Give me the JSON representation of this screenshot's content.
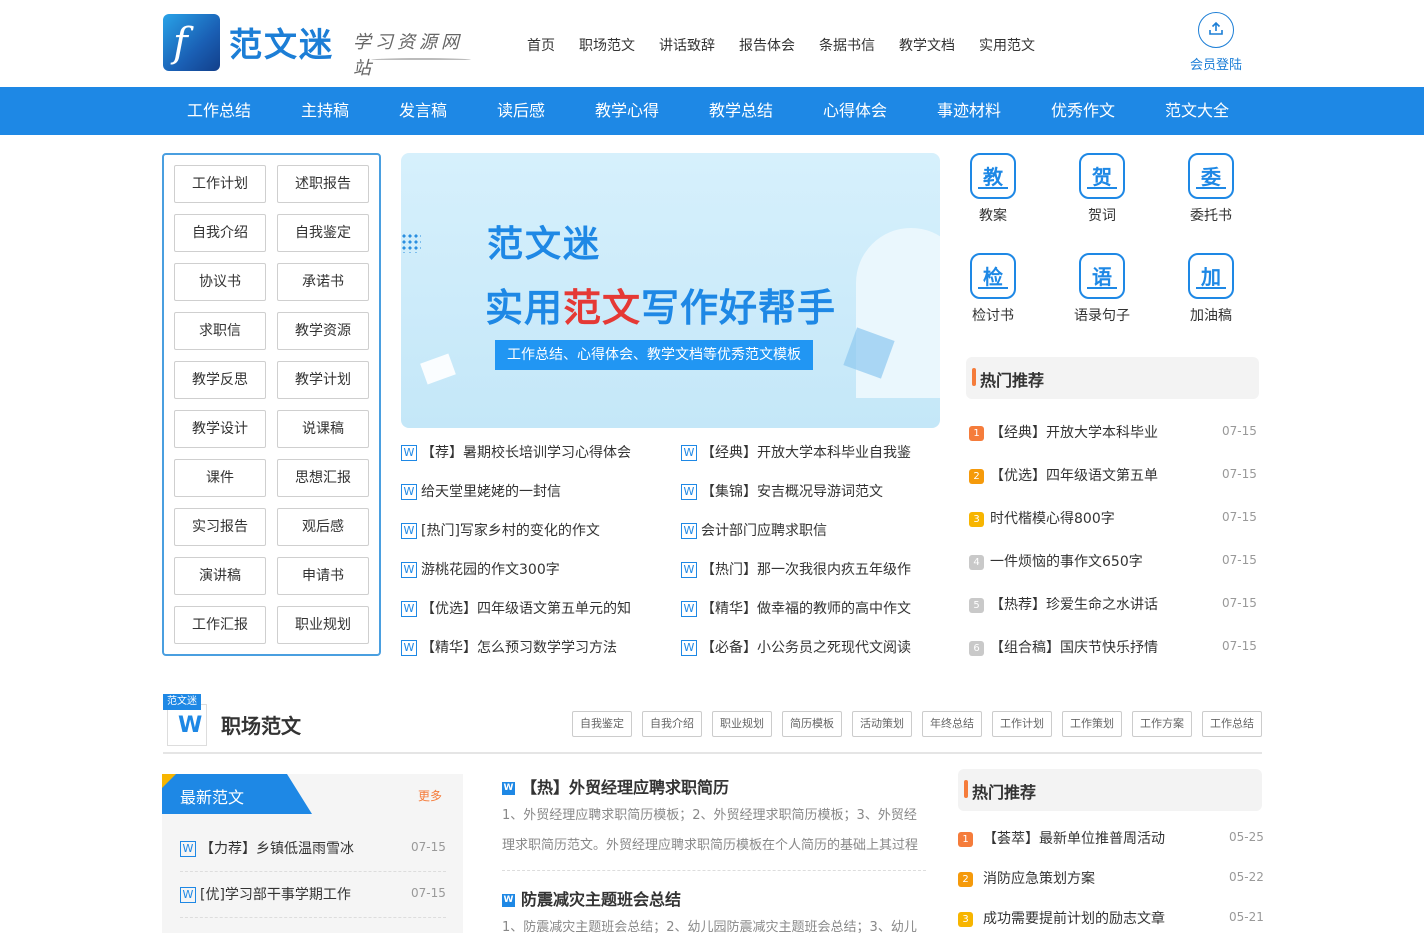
{
  "header": {
    "brand": "范文迷",
    "slogan": "学习资源网站",
    "nav": [
      "首页",
      "职场范文",
      "讲话致辞",
      "报告体会",
      "条据书信",
      "教学文档",
      "实用范文"
    ],
    "login_label": "会员登陆"
  },
  "bluenav": [
    "工作总结",
    "主持稿",
    "发言稿",
    "读后感",
    "教学心得",
    "教学总结",
    "心得体会",
    "事迹材料",
    "优秀作文",
    "范文大全"
  ],
  "categories": [
    "工作计划",
    "述职报告",
    "自我介绍",
    "自我鉴定",
    "协议书",
    "承诺书",
    "求职信",
    "教学资源",
    "教学反思",
    "教学计划",
    "教学设计",
    "说课稿",
    "课件",
    "思想汇报",
    "实习报告",
    "观后感",
    "演讲稿",
    "申请书",
    "工作汇报",
    "职业规划"
  ],
  "banner": {
    "brand": "范文迷",
    "title_pre": "实用",
    "title_red": "范文",
    "title_post": "写作好帮手",
    "subtitle": "工作总结、心得体会、教学文档等优秀范文模板"
  },
  "articles_left": [
    "【荐】暑期校长培训学习心得体会",
    "给天堂里姥姥的一封信",
    "[热门]写家乡村的变化的作文",
    "游桃花园的作文300字",
    "【优选】四年级语文第五单元的知",
    "【精华】怎么预习数学学习方法"
  ],
  "articles_right": [
    "【经典】开放大学本科毕业自我鉴",
    "【集锦】安吉概况导游词范文",
    "会计部门应聘求职信",
    "【热门】那一次我很内疚五年级作",
    "【精华】做幸福的教师的高中作文",
    "【必备】小公务员之死现代文阅读"
  ],
  "icons": [
    {
      "char": "教",
      "label": "教案"
    },
    {
      "char": "贺",
      "label": "贺词"
    },
    {
      "char": "委",
      "label": "委托书"
    },
    {
      "char": "检",
      "label": "检讨书"
    },
    {
      "char": "语",
      "label": "语录句子"
    },
    {
      "char": "加",
      "label": "加油稿"
    }
  ],
  "hot1": {
    "title": "热门推荐",
    "items": [
      {
        "n": "1",
        "text": "【经典】开放大学本科毕业",
        "date": "07-15"
      },
      {
        "n": "2",
        "text": "【优选】四年级语文第五单",
        "date": "07-15"
      },
      {
        "n": "3",
        "text": "时代楷模心得800字",
        "date": "07-15"
      },
      {
        "n": "4",
        "text": "一件烦恼的事作文650字",
        "date": "07-15"
      },
      {
        "n": "5",
        "text": "【热荐】珍爱生命之水讲话",
        "date": "07-15"
      },
      {
        "n": "6",
        "text": "【组合稿】国庆节快乐抒情",
        "date": "07-15"
      }
    ],
    "num_colors": [
      "#f57c3b",
      "#f59a0b",
      "#f7b500",
      "#c9c9c9",
      "#c9c9c9",
      "#c9c9c9"
    ]
  },
  "section2": {
    "logo_tag": "范文迷",
    "logo_letter": "W",
    "title": "职场范文",
    "tags": [
      "自我鉴定",
      "自我介绍",
      "职业规划",
      "简历模板",
      "活动策划",
      "年终总结",
      "工作计划",
      "工作策划",
      "工作方案",
      "工作总结"
    ],
    "newest": {
      "title": "最新范文",
      "more": "更多",
      "items": [
        {
          "text": "【力荐】乡镇低温雨雪冰",
          "date": "07-15"
        },
        {
          "text": "[优]学习部干事学期工作",
          "date": "07-15"
        }
      ]
    },
    "featured": [
      {
        "title": "【热】外贸经理应聘求职简历",
        "desc": "1、外贸经理应聘求职简历模板；2、外贸经理求职简历模板；3、外贸经理求职简历范文。外贸经理应聘求职简历模板在个人简历的基础上其过程"
      },
      {
        "title": "防震减灾主题班会总结",
        "desc": "1、防震减灾主题班会总结；2、幼儿园防震减灾主题班会总结；3、幼儿"
      }
    ],
    "hot2": {
      "title": "热门推荐",
      "items": [
        {
          "n": "1",
          "text": "【荟萃】最新单位推普周活动",
          "date": "05-25"
        },
        {
          "n": "2",
          "text": "消防应急策划方案",
          "date": "05-22"
        },
        {
          "n": "3",
          "text": "成功需要提前计划的励志文章",
          "date": "05-21"
        }
      ]
    }
  }
}
